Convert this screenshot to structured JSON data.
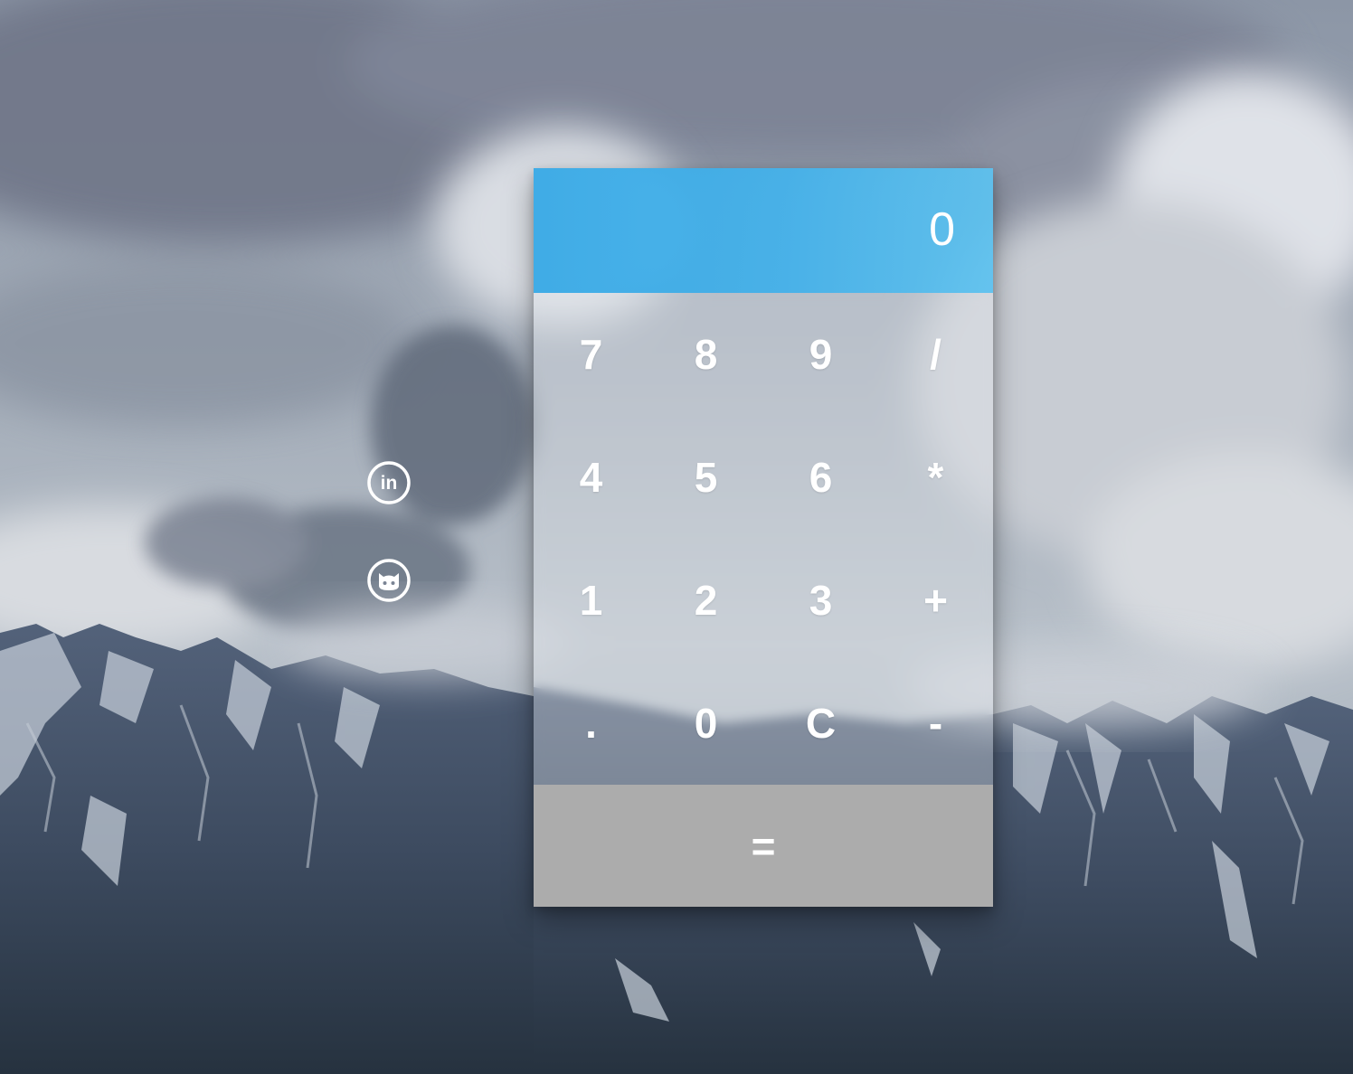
{
  "app": {
    "display": {
      "value": "0"
    },
    "keys": [
      {
        "label": "7",
        "name": "key-7"
      },
      {
        "label": "8",
        "name": "key-8"
      },
      {
        "label": "9",
        "name": "key-9"
      },
      {
        "label": "/",
        "name": "key-divide"
      },
      {
        "label": "4",
        "name": "key-4"
      },
      {
        "label": "5",
        "name": "key-5"
      },
      {
        "label": "6",
        "name": "key-6"
      },
      {
        "label": "*",
        "name": "key-multiply"
      },
      {
        "label": "1",
        "name": "key-1"
      },
      {
        "label": "2",
        "name": "key-2"
      },
      {
        "label": "3",
        "name": "key-3"
      },
      {
        "label": "+",
        "name": "key-plus"
      },
      {
        "label": ".",
        "name": "key-decimal"
      },
      {
        "label": "0",
        "name": "key-0"
      },
      {
        "label": "C",
        "name": "key-clear"
      },
      {
        "label": "-",
        "name": "key-minus"
      }
    ],
    "equals_label": "="
  },
  "social": {
    "linkedin_icon": "linkedin-icon",
    "github_icon": "github-icon"
  },
  "colors": {
    "display_bg": "#3fb0e8",
    "display_text": "#ffffff",
    "key_text": "#ffffff",
    "equals_bg": "#acacac",
    "icon": "#ffffff"
  }
}
